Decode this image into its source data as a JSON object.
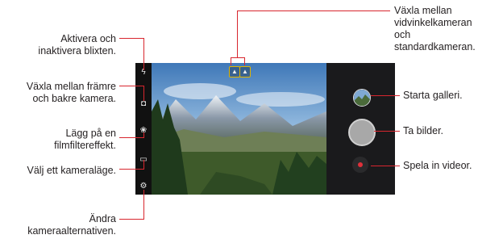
{
  "labels": {
    "flash": [
      "Aktivera och",
      "inaktivera blixten."
    ],
    "switch_camera": [
      "Växla mellan främre",
      "och bakre kamera."
    ],
    "film_filter": [
      "Lägg på en",
      "filmfiltereffekt."
    ],
    "camera_mode": [
      "Välj ett kameraläge."
    ],
    "camera_options": [
      "Ändra",
      "kameraalternativen."
    ],
    "wide_angle": [
      "Växla mellan",
      "vidvinkelkameran",
      "och",
      "standardkameran."
    ],
    "gallery": [
      "Starta galleri."
    ],
    "take_photo": [
      "Ta bilder."
    ],
    "record_video": [
      "Spela in videor."
    ]
  },
  "colors": {
    "callout": "#d8262e",
    "shutter": "#b0b0b0",
    "record": "#e0303a",
    "lens_highlight": "#e0b400"
  },
  "icons": {
    "flash": "flash-off-icon",
    "switch": "switch-camera-icon",
    "filter": "film-filter-icon",
    "mode": "camera-mode-icon",
    "settings": "gear-icon",
    "wide": "wide-angle-lens-icon",
    "standard": "standard-lens-icon"
  }
}
